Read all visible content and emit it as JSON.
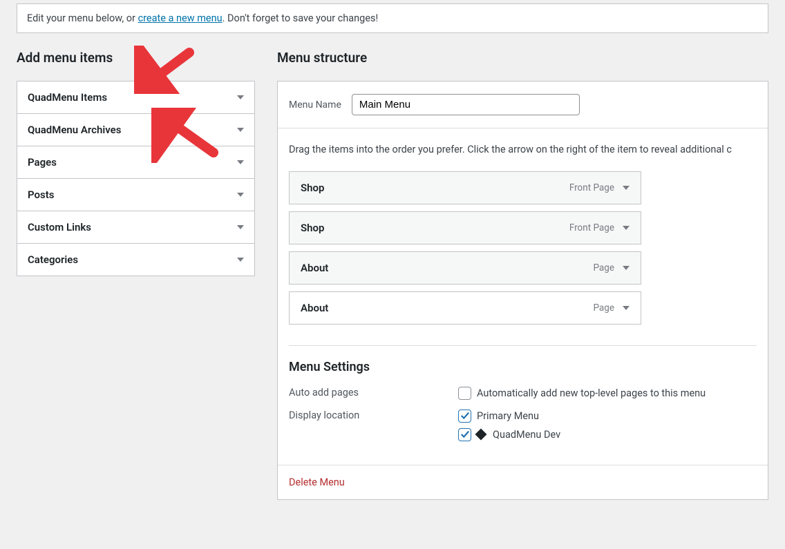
{
  "notice": {
    "before": "Edit your menu below, or ",
    "link": "create a new menu",
    "after": ". Don't forget to save your changes!"
  },
  "sidebar": {
    "title": "Add menu items",
    "items": [
      {
        "label": "QuadMenu Items"
      },
      {
        "label": "QuadMenu Archives"
      },
      {
        "label": "Pages"
      },
      {
        "label": "Posts"
      },
      {
        "label": "Custom Links"
      },
      {
        "label": "Categories"
      }
    ]
  },
  "structure": {
    "title": "Menu structure",
    "name_label": "Menu Name",
    "name_value": "Main Menu",
    "drag_text": "Drag the items into the order you prefer. Click the arrow on the right of the item to reveal additional c",
    "items": [
      {
        "title": "Shop",
        "type": "Front Page"
      },
      {
        "title": "Shop",
        "type": "Front Page"
      },
      {
        "title": "About",
        "type": "Page"
      },
      {
        "title": "About",
        "type": "Page"
      }
    ]
  },
  "settings": {
    "title": "Menu Settings",
    "auto_add_label": "Auto add pages",
    "auto_add_text": "Automatically add new top-level pages to this menu",
    "display_label": "Display location",
    "loc1": "Primary Menu",
    "loc2": "QuadMenu Dev"
  },
  "footer": {
    "delete": "Delete Menu"
  }
}
